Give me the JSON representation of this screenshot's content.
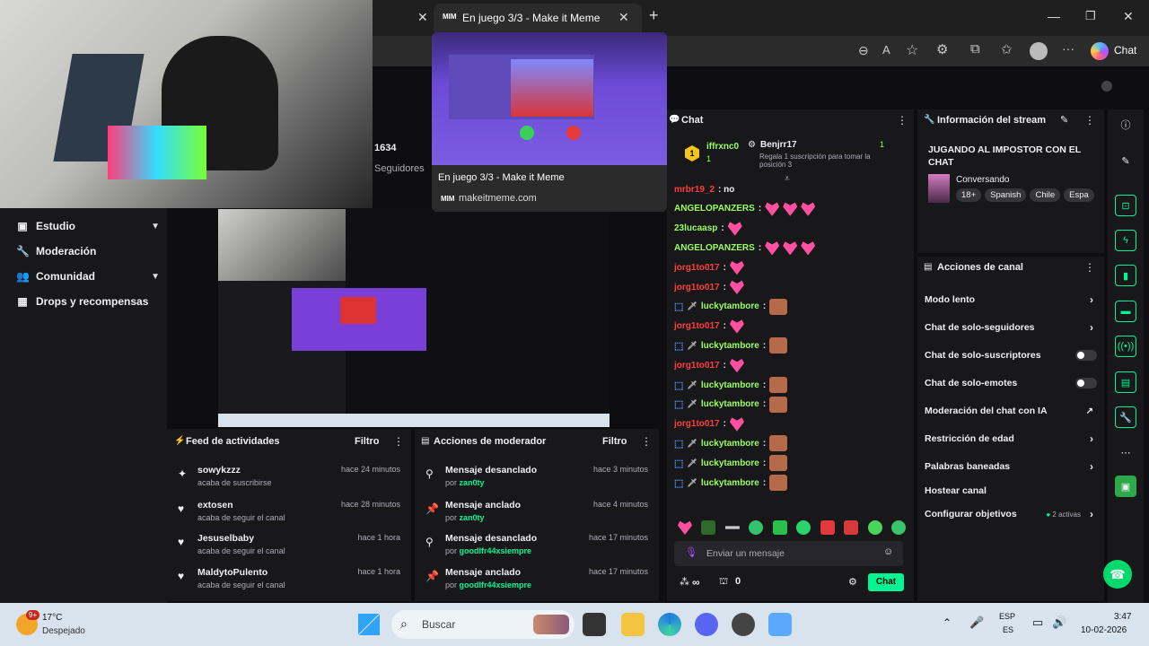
{
  "browser": {
    "tab_title": "En juego 3/3 - Make it Meme",
    "tab_favicon": "MIM",
    "chat_button": "Chat",
    "popup": {
      "title": "En juego 3/3 - Make it Meme",
      "domain": "makeitmeme.com",
      "favicon": "MIM"
    }
  },
  "stats": {
    "number": "1634",
    "label": "Seguidores"
  },
  "nav": {
    "items": [
      {
        "label": "Estudio",
        "icon": "camera-icon",
        "has_chevron": true
      },
      {
        "label": "Moderación",
        "icon": "wrench-icon",
        "has_chevron": false
      },
      {
        "label": "Comunidad",
        "icon": "people-icon",
        "has_chevron": true
      },
      {
        "label": "Drops y recompensas",
        "icon": "gift-icon",
        "has_chevron": false
      }
    ]
  },
  "activity_feed": {
    "title": "Feed de actividades",
    "filter": "Filtro",
    "items": [
      {
        "user": "sowykzzz",
        "action": "acaba de suscribirse",
        "time": "hace 24 minutos"
      },
      {
        "user": "extosen",
        "action": "acaba de seguir el canal",
        "time": "hace 28 minutos"
      },
      {
        "user": "Jesuselbaby",
        "action": "acaba de seguir el canal",
        "time": "hace 1 hora"
      },
      {
        "user": "MaldytoPulento",
        "action": "acaba de seguir el canal",
        "time": "hace 1 hora"
      }
    ]
  },
  "mod_actions": {
    "title": "Acciones de moderador",
    "filter": "Filtro",
    "items": [
      {
        "action": "Mensaje desanclado",
        "by": "por",
        "mod": "zan0ty",
        "time": "hace 3 minutos"
      },
      {
        "action": "Mensaje anclado",
        "by": "por",
        "mod": "zan0ty",
        "time": "hace 4 minutos"
      },
      {
        "action": "Mensaje desanclado",
        "by": "por",
        "mod": "goodlfr44xsiempre",
        "time": "hace 17 minutos"
      },
      {
        "action": "Mensaje anclado",
        "by": "por",
        "mod": "goodlfr44xsiempre",
        "time": "hace 17 minutos"
      }
    ]
  },
  "chat": {
    "title": "Chat",
    "gift_rank": "1",
    "gifter": "iffrxnc0",
    "gifter_count": "1",
    "top_user": "Benjrr17",
    "top_count": "1",
    "gift_note": "Regala 1 suscripción para tomar la posición 3",
    "messages": [
      {
        "user": "mrbr19_2",
        "text": ": no",
        "color": "#ff3d3d",
        "emotes": 0
      },
      {
        "user": "ANGELOPANZERS",
        "text": ":",
        "color": "#9aff5a",
        "emotes": 3
      },
      {
        "user": "23lucaasp",
        "text": ":",
        "color": "#9aff5a",
        "emotes": 1
      },
      {
        "user": "ANGELOPANZERS",
        "text": ":",
        "color": "#9aff5a",
        "emotes": 3
      },
      {
        "user": "jorg1to017",
        "text": ":",
        "color": "#ff3d3d",
        "emotes": 1
      },
      {
        "user": "jorg1to017",
        "text": ":",
        "color": "#ff3d3d",
        "emotes": 1
      },
      {
        "user": "luckytambore",
        "text": ":",
        "color": "#9aff5a",
        "emotes": 0,
        "face": true,
        "badge": true
      },
      {
        "user": "jorg1to017",
        "text": ":",
        "color": "#ff3d3d",
        "emotes": 1
      },
      {
        "user": "luckytambore",
        "text": ":",
        "color": "#9aff5a",
        "emotes": 0,
        "face": true,
        "badge": true
      },
      {
        "user": "jorg1to017",
        "text": ":",
        "color": "#ff3d3d",
        "emotes": 1
      },
      {
        "user": "luckytambore",
        "text": ":",
        "color": "#9aff5a",
        "emotes": 0,
        "face": true,
        "badge": true
      },
      {
        "user": "luckytambore",
        "text": ":",
        "color": "#9aff5a",
        "emotes": 0,
        "face": true,
        "badge": true
      },
      {
        "user": "jorg1to017",
        "text": ":",
        "color": "#ff3d3d",
        "emotes": 1
      },
      {
        "user": "luckytambore",
        "text": ":",
        "color": "#9aff5a",
        "emotes": 0,
        "face": true,
        "badge": true
      },
      {
        "user": "luckytambore",
        "text": ":",
        "color": "#9aff5a",
        "emotes": 0,
        "face": true,
        "badge": true
      },
      {
        "user": "luckytambore",
        "text": ":",
        "color": "#9aff5a",
        "emotes": 0,
        "face": true,
        "badge": true
      }
    ],
    "input_placeholder": "Enviar un mensaje",
    "points": "∞",
    "pins": "0",
    "send_button": "Chat"
  },
  "stream_info": {
    "title": "Información del stream",
    "stream_title": "JUGANDO AL IMPOSTOR CON EL CHAT",
    "category": "Conversando",
    "tags": [
      "18+",
      "Spanish",
      "Chile",
      "Espa"
    ]
  },
  "channel_actions": {
    "title": "Acciones de canal",
    "items": [
      {
        "label": "Modo lento",
        "control": "chevron"
      },
      {
        "label": "Chat de solo-seguidores",
        "control": "chevron"
      },
      {
        "label": "Chat de solo-suscriptores",
        "control": "toggle"
      },
      {
        "label": "Chat de solo-emotes",
        "control": "toggle"
      },
      {
        "label": "Moderación del chat con IA",
        "control": "external"
      },
      {
        "label": "Restricción de edad",
        "control": "chevron"
      },
      {
        "label": "Palabras baneadas",
        "control": "chevron"
      },
      {
        "label": "Hostear canal",
        "control": "none"
      },
      {
        "label": "Configurar objetivos",
        "control": "chevron",
        "extra": "2 activas"
      }
    ]
  },
  "taskbar": {
    "temp": "17°C",
    "weather": "Despejado",
    "weather_badge": "9+",
    "search": "Buscar",
    "lang1": "ESP",
    "lang2": "ES",
    "time": "3:47",
    "date": "10-02-2026"
  },
  "colors": {
    "accent": "#00f593",
    "chat_green": "#9aff5a",
    "chat_red": "#ff3d3d",
    "purple": "#6d4bd8"
  }
}
